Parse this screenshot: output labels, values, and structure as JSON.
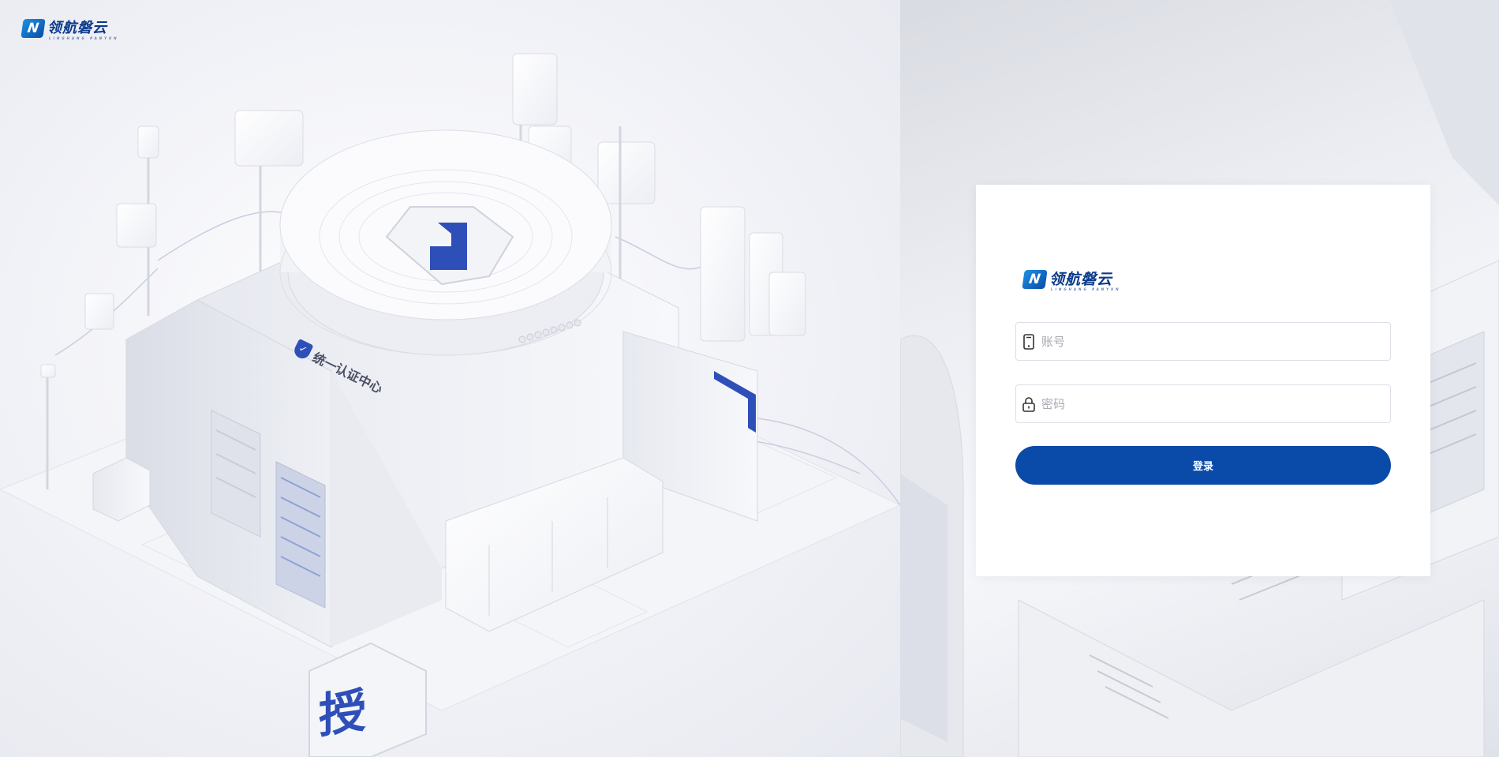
{
  "brand": {
    "mark": "N",
    "name": "领航磐云",
    "tagline": "LINGHANG PANYUN"
  },
  "hero": {
    "building_label": "统一认证中心",
    "shield_char": "授"
  },
  "login": {
    "account_placeholder": "账号",
    "password_placeholder": "密码",
    "submit_label": "登录"
  },
  "colors": {
    "primary": "#0a4aa8",
    "accent": "#2f4fb8",
    "brand_text": "#0b3a8a"
  }
}
